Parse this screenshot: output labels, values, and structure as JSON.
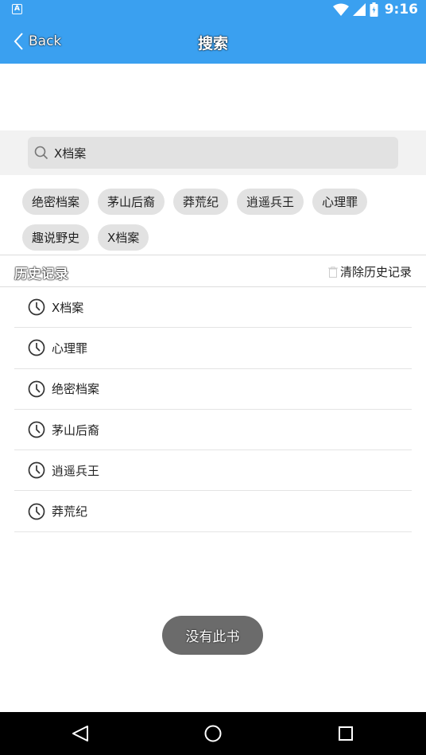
{
  "status_bar": {
    "time": "9:16",
    "icons": [
      "app-notification-icon",
      "wifi-icon",
      "signal-icon",
      "battery-icon"
    ]
  },
  "header": {
    "back_label": "Back",
    "title": "搜索"
  },
  "search": {
    "value": "X档案"
  },
  "hot_tags": [
    {
      "label": "绝密档案"
    },
    {
      "label": "茅山后裔"
    },
    {
      "label": "莽荒纪"
    },
    {
      "label": "逍遥兵王"
    },
    {
      "label": "心理罪"
    },
    {
      "label": "趣说野史"
    },
    {
      "label": "X档案"
    }
  ],
  "history": {
    "title": "历史记录",
    "clear_label": "清除历史记录",
    "items": [
      {
        "label": "X档案"
      },
      {
        "label": "心理罪"
      },
      {
        "label": "绝密档案"
      },
      {
        "label": "茅山后裔"
      },
      {
        "label": "逍遥兵王"
      },
      {
        "label": "莽荒纪"
      }
    ]
  },
  "toast": {
    "message": "没有此书"
  },
  "colors": {
    "primary": "#3aa0f0",
    "tag_bg": "#e2e2e2",
    "toast_bg": "#6b6b6b"
  }
}
